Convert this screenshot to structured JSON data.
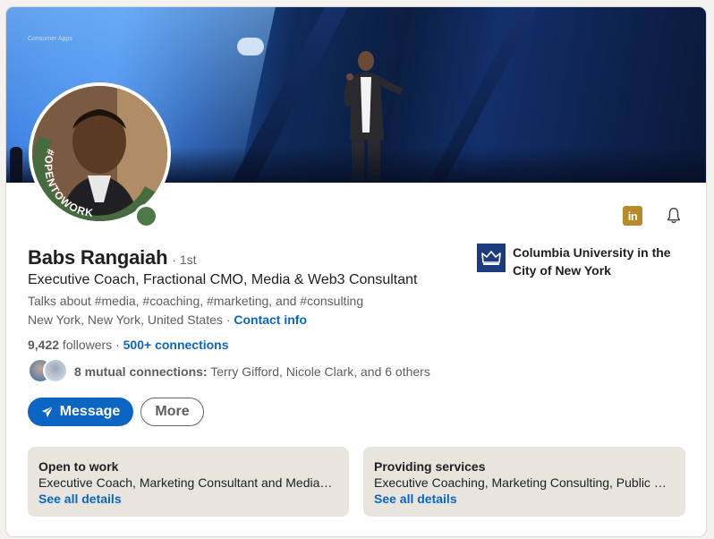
{
  "colors": {
    "brand_blue": "#0a66c2",
    "open_to_work_green": "#4b7a44",
    "linkedin_badge": "#b88a2a",
    "info_box_bg": "#e8e5df"
  },
  "banner": {
    "screen_text": "Consumer Apps"
  },
  "avatar": {
    "frame_text": "#OPENTOWORK"
  },
  "profile": {
    "name": "Babs Rangaiah",
    "degree": "· 1st",
    "headline": "Executive Coach, Fractional CMO, Media & Web3 Consultant",
    "talks_about": "Talks about #media, #coaching, #marketing, and #consulting",
    "location": "New York, New York, United States",
    "location_separator": " · ",
    "contact_link": "Contact info",
    "followers_count": "9,422",
    "followers_label": " followers",
    "stats_separator": " · ",
    "connections": "500+ connections",
    "mutual_bold": "8 mutual connections:",
    "mutual_rest": " Terry Gifford, Nicole Clark, and 6 others"
  },
  "icons": {
    "linkedin_badge_text": "in",
    "bell": "bell-icon",
    "send": "paper-plane-icon"
  },
  "actions": {
    "message_label": "Message",
    "more_label": "More"
  },
  "education": {
    "school_name": "Columbia University in the City of New York"
  },
  "info_boxes": [
    {
      "title": "Open to work",
      "description": "Executive Coach, Marketing Consultant and Media Consultant roles",
      "link": "See all details"
    },
    {
      "title": "Providing services",
      "description": "Executive Coaching, Marketing Consulting, Public Relations",
      "link": "See all details"
    }
  ]
}
